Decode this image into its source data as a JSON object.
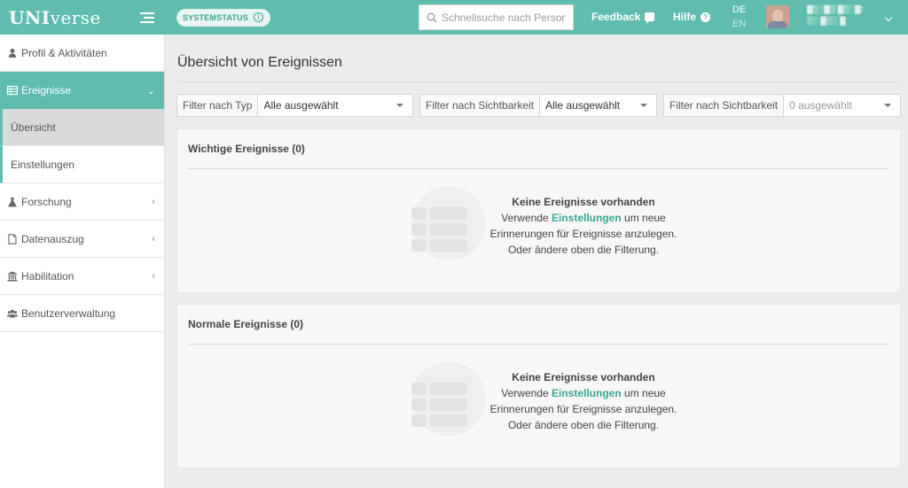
{
  "brand": {
    "bold": "UNI",
    "rest": "verse"
  },
  "header": {
    "status_badge": "SYSTEMSTATUS",
    "search_placeholder": "Schnellsuche nach Personen",
    "feedback": "Feedback",
    "help": "Hilfe",
    "lang_de": "DE",
    "lang_en": "EN",
    "user_line1": "▓▒░▓▒ ▓▒░▓:",
    "user_line2": "▒░ ▓▒░ ▓"
  },
  "sidebar": {
    "items": [
      {
        "label": "Profil & Aktivitäten",
        "icon": "user-icon"
      },
      {
        "label": "Ereignisse",
        "icon": "table-icon"
      },
      {
        "label": "Übersicht"
      },
      {
        "label": "Einstellungen"
      },
      {
        "label": "Forschung",
        "icon": "flask-icon"
      },
      {
        "label": "Datenauszug",
        "icon": "file-icon"
      },
      {
        "label": "Habilitation",
        "icon": "university-icon"
      },
      {
        "label": "Benutzerverwaltung",
        "icon": "users-icon"
      }
    ]
  },
  "main": {
    "title": "Übersicht von Ereignissen",
    "filters": [
      {
        "label": "Filter nach Typ",
        "value": "Alle ausgewählt"
      },
      {
        "label": "Filter nach Sichtbarkeit",
        "value": "Alle ausgewählt"
      },
      {
        "label": "Filter nach Sichtbarkeit",
        "value": "0 ausgewählt"
      }
    ],
    "panels": [
      {
        "title": "Wichtige Ereignisse (0)",
        "empty_title": "Keine Ereignisse vorhanden",
        "empty_pre": "Verwende",
        "empty_link": "Einstellungen",
        "empty_post": "um neue",
        "empty_line3": "Erinnerungen für Ereignisse anzulegen.",
        "empty_line4": "Oder ändere oben die Filterung."
      },
      {
        "title": "Normale Ereignisse (0)",
        "empty_title": "Keine Ereignisse vorhanden",
        "empty_pre": "Verwende",
        "empty_link": "Einstellungen",
        "empty_post": "um neue",
        "empty_line3": "Erinnerungen für Ereignisse anzulegen.",
        "empty_line4": "Oder ändere oben die Filterung."
      }
    ]
  },
  "colors": {
    "accent": "#5fbcae",
    "link": "#3aa592"
  }
}
